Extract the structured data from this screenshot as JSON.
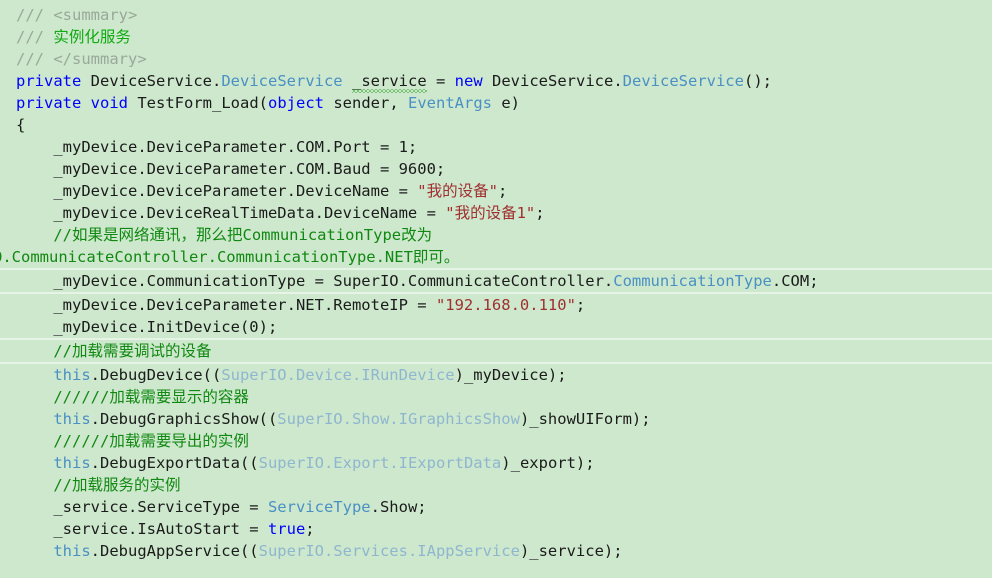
{
  "editor": {
    "language": "csharp",
    "background_color": "#cde8cd",
    "current_line_index": 12,
    "colors": {
      "keyword": "#0000ff",
      "type": "#4a90c4",
      "type_dim": "#8fb6cf",
      "string": "#a03030",
      "comment": "#118811",
      "doc_comment": "#9aa89a",
      "doc_comment_text": "#11aa11",
      "plain": "#1b1b1b",
      "current_line_border": "#e6f4e6",
      "squiggle": "#1e9e1e"
    }
  },
  "lines": [
    {
      "id": 0,
      "text": "/// <summary>"
    },
    {
      "id": 1,
      "text": "/// 实例化服务"
    },
    {
      "id": 2,
      "text": "/// </summary>"
    },
    {
      "id": 3,
      "text": "private DeviceService.DeviceService _service = new DeviceService.DeviceService();"
    },
    {
      "id": 4,
      "text": "private void TestForm_Load(object sender, EventArgs e)"
    },
    {
      "id": 5,
      "text": "{"
    },
    {
      "id": 6,
      "text": "    _myDevice.DeviceParameter.COM.Port = 1;"
    },
    {
      "id": 7,
      "text": "    _myDevice.DeviceParameter.COM.Baud = 9600;"
    },
    {
      "id": 8,
      "text": "    _myDevice.DeviceParameter.DeviceName = \"我的设备\";"
    },
    {
      "id": 9,
      "text": "    _myDevice.DeviceRealTimeData.DeviceName = \"我的设备1\";"
    },
    {
      "id": 10,
      "text": "    //如果是网络通讯，那么把CommunicationType改为"
    },
    {
      "id": 11,
      "text": "O.CommunicateController.CommunicationType.NET即可。"
    },
    {
      "id": 12,
      "text": "    _myDevice.CommunicationType = SuperIO.CommunicateController.CommunicationType.COM;"
    },
    {
      "id": 13,
      "text": "    _myDevice.DeviceParameter.NET.RemoteIP = \"192.168.0.110\";"
    },
    {
      "id": 14,
      "text": "    _myDevice.InitDevice(0);"
    },
    {
      "id": 15,
      "text": "    //加载需要调试的设备"
    },
    {
      "id": 16,
      "text": "    this.DebugDevice((SuperIO.Device.IRunDevice)_myDevice);"
    },
    {
      "id": 17,
      "text": "    //////加载需要显示的容器"
    },
    {
      "id": 18,
      "text": "    this.DebugGraphicsShow((SuperIO.Show.IGraphicsShow)_showUIForm);"
    },
    {
      "id": 19,
      "text": "    //////加载需要导出的实例"
    },
    {
      "id": 20,
      "text": "    this.DebugExportData((SuperIO.Export.IExportData)_export);"
    },
    {
      "id": 21,
      "text": "    //加载服务的实例"
    },
    {
      "id": 22,
      "text": "    _service.ServiceType = ServiceType.Show;"
    },
    {
      "id": 23,
      "text": "    _service.IsAutoStart = true;"
    },
    {
      "id": 24,
      "text": "    this.DebugAppService((SuperIO.Services.IAppService)_service);"
    }
  ],
  "tokens": {
    "l0_slashes": "/// ",
    "l0_tag": "<summary>",
    "l1_slashes": "/// ",
    "l1_text": "实例化服务",
    "l2_slashes": "/// ",
    "l2_tag": "</summary>",
    "l3_private": "private",
    "l3_sp1": " ",
    "l3_ns1": "DeviceService.",
    "l3_type1": "DeviceService",
    "l3_sp2": " ",
    "l3_var": "_service",
    "l3_eq": " = ",
    "l3_new": "new",
    "l3_sp3": " ",
    "l3_ns2": "DeviceService.",
    "l3_type2": "DeviceService",
    "l3_tail": "();",
    "l4_private": "private",
    "l4_sp1": " ",
    "l4_void": "void",
    "l4_sp2": " ",
    "l4_name": "TestForm_Load(",
    "l4_object": "object",
    "l4_sender": " sender, ",
    "l4_eventargs": "EventArgs",
    "l4_tail": " e)",
    "l5_brace": "{",
    "l6_text": "    _myDevice.DeviceParameter.COM.Port = 1;",
    "l7_text": "    _myDevice.DeviceParameter.COM.Baud = 9600;",
    "l8_head": "    _myDevice.DeviceParameter.DeviceName = ",
    "l8_str": "\"我的设备\"",
    "l8_tail": ";",
    "l9_head": "    _myDevice.DeviceRealTimeData.DeviceName = ",
    "l9_str": "\"我的设备1\"",
    "l9_tail": ";",
    "l10_text": "    //如果是网络通讯，那么把CommunicationType改为",
    "l11_text": "O.CommunicateController.CommunicationType.NET即可。",
    "l12_head": "    _myDevice.CommunicationType = SuperIO.CommunicateController.",
    "l12_type": "CommunicationType",
    "l12_tail": ".COM;",
    "l13_head": "    _myDevice.DeviceParameter.NET.RemoteIP = ",
    "l13_str": "\"192.168.0.110\"",
    "l13_tail": ";",
    "l14_text": "    _myDevice.InitDevice(0);",
    "l15_text": "    //加载需要调试的设备",
    "l16_this": "this",
    "l16_mid": ".DebugDevice((",
    "l16_cast": "SuperIO.Device.IRunDevice",
    "l16_tail": ")_myDevice);",
    "l17_text": "    //////加载需要显示的容器",
    "l18_this": "this",
    "l18_mid": ".DebugGraphicsShow((",
    "l18_cast": "SuperIO.Show.IGraphicsShow",
    "l18_tail": ")_showUIForm);",
    "l19_text": "    //////加载需要导出的实例",
    "l20_this": "this",
    "l20_mid": ".DebugExportData((",
    "l20_cast": "SuperIO.Export.IExportData",
    "l20_tail": ")_export);",
    "l21_text": "    //加载服务的实例",
    "l22_head": "    _service.ServiceType = ",
    "l22_type": "ServiceType",
    "l22_tail": ".Show;",
    "l23_head": "    _service.IsAutoStart = ",
    "l23_true": "true",
    "l23_tail": ";",
    "l24_this": "this",
    "l24_mid": ".DebugAppService((",
    "l24_cast": "SuperIO.Services.IAppService",
    "l24_tail": ")_service);"
  }
}
